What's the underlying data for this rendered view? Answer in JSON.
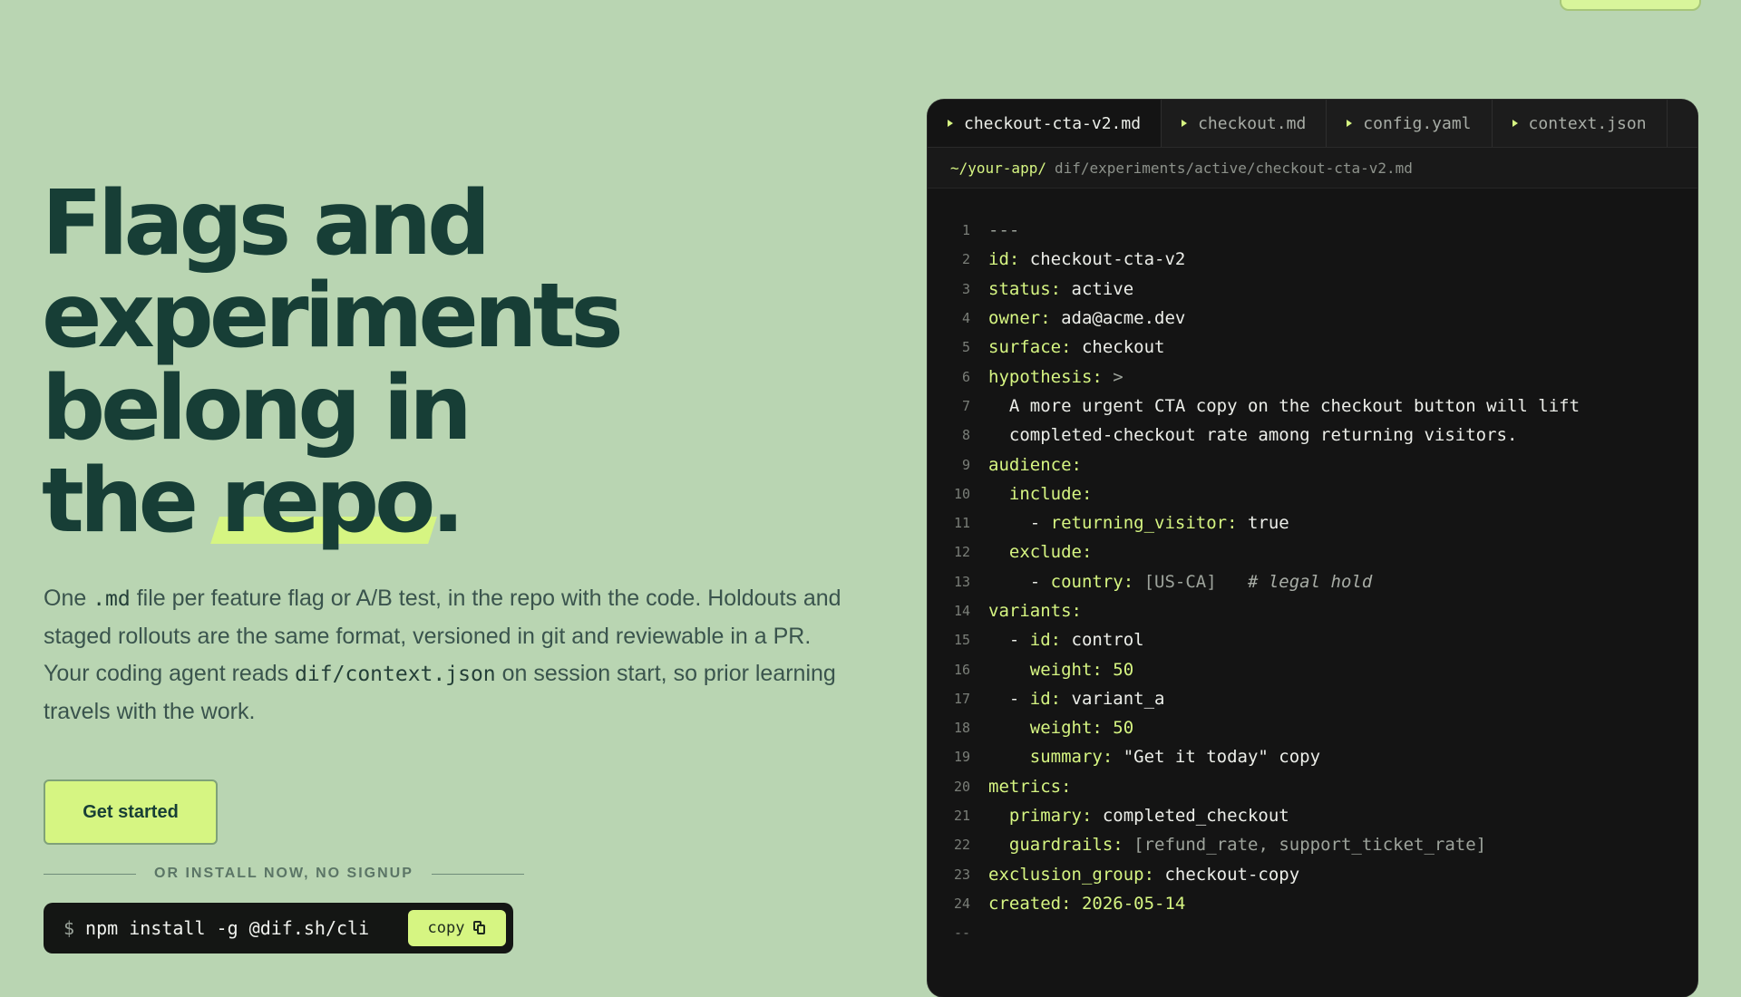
{
  "hero": {
    "title_lines": [
      "Flags and",
      "experiments",
      "belong in",
      "the"
    ],
    "title_highlight": "repo",
    "title_period": ".",
    "desc": {
      "p1": "One ",
      "c1": ".md",
      "p2": " file per feature flag or A/B test, in the repo with the code. Holdouts and staged rollouts are the same format, versioned in git and reviewable in a PR. Your coding agent reads ",
      "c2": "dif/context.json",
      "p3": " on session start, so prior learning travels with the work."
    },
    "cta_label": "Get started",
    "install_divider": "OR INSTALL NOW, NO SIGNUP",
    "install_prompt": "$",
    "install_command": "npm install -g @dif.sh/cli",
    "copy_label": "copy"
  },
  "editor": {
    "tabs": [
      {
        "label": "checkout-cta-v2.md",
        "active": true
      },
      {
        "label": "checkout.md",
        "active": false
      },
      {
        "label": "config.yaml",
        "active": false
      },
      {
        "label": "context.json",
        "active": false
      }
    ],
    "path_root": "~/your-app/",
    "path_rest": "dif/experiments/active/checkout-cta-v2.md",
    "lines": [
      {
        "n": "1",
        "i": "",
        "k": "",
        "v": "---",
        "vc": "m"
      },
      {
        "n": "2",
        "i": "",
        "k": "id:",
        "v": " checkout-cta-v2",
        "vc": "v"
      },
      {
        "n": "3",
        "i": "",
        "k": "status:",
        "v": " active",
        "vc": "v"
      },
      {
        "n": "4",
        "i": "",
        "k": "owner:",
        "v": " ada@acme.dev",
        "vc": "v"
      },
      {
        "n": "5",
        "i": "",
        "k": "surface:",
        "v": " checkout",
        "vc": "v"
      },
      {
        "n": "6",
        "i": "",
        "k": "hypothesis:",
        "v": " >",
        "vc": "m"
      },
      {
        "n": "7",
        "i": "  ",
        "k": "",
        "v": "A more urgent CTA copy on the checkout button will lift",
        "vc": "v"
      },
      {
        "n": "8",
        "i": "  ",
        "k": "",
        "v": "completed-checkout rate among returning visitors.",
        "vc": "v"
      },
      {
        "n": "9",
        "i": "",
        "k": "audience:",
        "v": "",
        "vc": "v"
      },
      {
        "n": "10",
        "i": "  ",
        "k": "include:",
        "v": "",
        "vc": "v"
      },
      {
        "n": "11",
        "i": "    - ",
        "k": "returning_visitor:",
        "v": " true",
        "vc": "v"
      },
      {
        "n": "12",
        "i": "  ",
        "k": "exclude:",
        "v": "",
        "vc": "v"
      },
      {
        "n": "13",
        "i": "    - ",
        "k": "country:",
        "v": " [US-CA]",
        "vc": "m",
        "comment": "   # legal hold"
      },
      {
        "n": "14",
        "i": "",
        "k": "variants:",
        "v": "",
        "vc": "v"
      },
      {
        "n": "15",
        "i": "  - ",
        "k": "id:",
        "v": " control",
        "vc": "v"
      },
      {
        "n": "16",
        "i": "    ",
        "k": "weight:",
        "v": " 50",
        "vc": "n"
      },
      {
        "n": "17",
        "i": "  - ",
        "k": "id:",
        "v": " variant_a",
        "vc": "v"
      },
      {
        "n": "18",
        "i": "    ",
        "k": "weight:",
        "v": " 50",
        "vc": "n"
      },
      {
        "n": "19",
        "i": "    ",
        "k": "summary:",
        "v": " \"Get it today\" copy",
        "vc": "v"
      },
      {
        "n": "20",
        "i": "",
        "k": "metrics:",
        "v": "",
        "vc": "v"
      },
      {
        "n": "21",
        "i": "  ",
        "k": "primary:",
        "v": " completed_checkout",
        "vc": "v"
      },
      {
        "n": "22",
        "i": "  ",
        "k": "guardrails:",
        "v": " [refund_rate, support_ticket_rate]",
        "vc": "m"
      },
      {
        "n": "23",
        "i": "",
        "k": "exclusion_group:",
        "v": " checkout-copy",
        "vc": "v"
      },
      {
        "n": "24",
        "i": "",
        "k": "created:",
        "v": " 2026-05-14",
        "vc": "n"
      },
      {
        "n": "--",
        "i": "",
        "k": "",
        "v": "",
        "vc": "v"
      }
    ]
  },
  "colors": {
    "background": "#b9d5b2",
    "accent": "#d6f582",
    "heading": "#173e36",
    "editor_bg": "#141414"
  }
}
